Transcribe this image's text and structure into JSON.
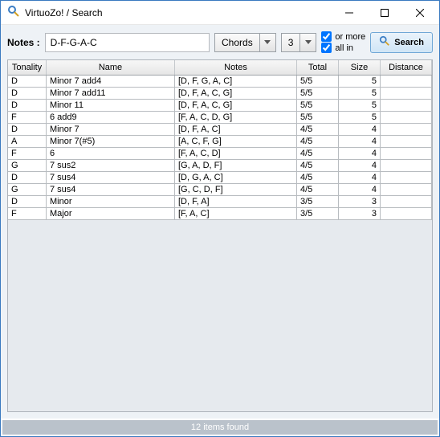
{
  "window": {
    "title": "VirtuoZo! / Search"
  },
  "toolbar": {
    "notes_label": "Notes :",
    "notes_value": "D-F-G-A-C",
    "mode": "Chords",
    "count": "3",
    "or_more": "or more",
    "all_in": "all in",
    "search": "Search"
  },
  "columns": {
    "tonality": "Tonality",
    "name": "Name",
    "notes": "Notes",
    "total": "Total",
    "size": "Size",
    "distance": "Distance"
  },
  "rows": [
    {
      "tonality": "D",
      "name": "Minor 7 add4",
      "notes": "[D, F, G, A, C]",
      "total": "5/5",
      "size": "5",
      "distance": ""
    },
    {
      "tonality": "D",
      "name": "Minor 7 add11",
      "notes": "[D, F, A, C, G]",
      "total": "5/5",
      "size": "5",
      "distance": ""
    },
    {
      "tonality": "D",
      "name": "Minor 11",
      "notes": "[D, F, A, C, G]",
      "total": "5/5",
      "size": "5",
      "distance": ""
    },
    {
      "tonality": "F",
      "name": "6 add9",
      "notes": "[F, A, C, D, G]",
      "total": "5/5",
      "size": "5",
      "distance": ""
    },
    {
      "tonality": "D",
      "name": "Minor 7",
      "notes": "[D, F, A, C]",
      "total": "4/5",
      "size": "4",
      "distance": ""
    },
    {
      "tonality": "A",
      "name": "Minor 7(#5)",
      "notes": "[A, C, F, G]",
      "total": "4/5",
      "size": "4",
      "distance": ""
    },
    {
      "tonality": "F",
      "name": "6",
      "notes": "[F, A, C, D]",
      "total": "4/5",
      "size": "4",
      "distance": ""
    },
    {
      "tonality": "G",
      "name": "7 sus2",
      "notes": "[G, A, D, F]",
      "total": "4/5",
      "size": "4",
      "distance": ""
    },
    {
      "tonality": "D",
      "name": "7 sus4",
      "notes": "[D, G, A, C]",
      "total": "4/5",
      "size": "4",
      "distance": ""
    },
    {
      "tonality": "G",
      "name": "7 sus4",
      "notes": "[G, C, D, F]",
      "total": "4/5",
      "size": "4",
      "distance": ""
    },
    {
      "tonality": "D",
      "name": "Minor",
      "notes": "[D, F, A]",
      "total": "3/5",
      "size": "3",
      "distance": ""
    },
    {
      "tonality": "F",
      "name": "Major",
      "notes": "[F, A, C]",
      "total": "3/5",
      "size": "3",
      "distance": ""
    }
  ],
  "status": "12 items found"
}
